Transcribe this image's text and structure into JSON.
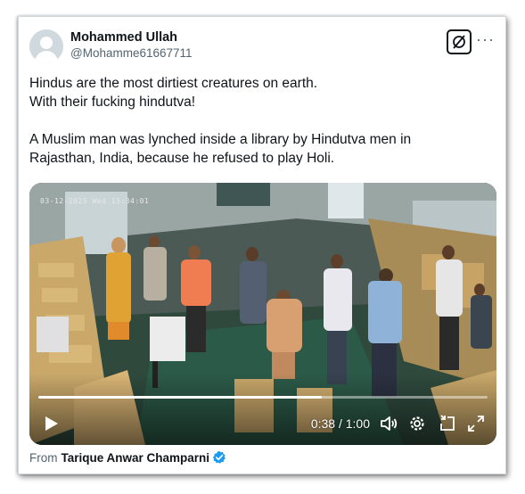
{
  "tweet": {
    "display_name": "Mohammed Ullah",
    "handle": "@Mohamme61667711",
    "text_lines": [
      "Hindus are the most dirtiest creatures on earth.",
      "With their fucking hindutva!",
      "A Muslim man was lynched inside a library by Hindutva men in",
      "Rajasthan, India, because he refused to play Holi."
    ],
    "actions": {
      "grok_icon": "grok-icon",
      "more_icon": "more-icon"
    }
  },
  "video": {
    "timestamp_overlay": "03-12-2025  Wed  15:34:01",
    "current_time": "0:38",
    "separator": " / ",
    "duration": "1:00",
    "progress_fraction": 0.63,
    "controls": [
      "play-icon",
      "volume-icon",
      "settings-icon",
      "minimize-icon",
      "fullscreen-icon"
    ]
  },
  "footer": {
    "prefix": "From",
    "source_name": "Tarique Anwar Champarni",
    "verified_color": "#1d9bf0"
  }
}
